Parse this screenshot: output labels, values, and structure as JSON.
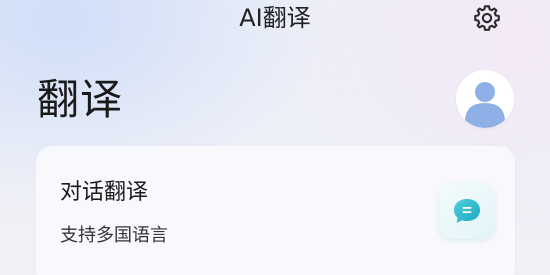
{
  "header": {
    "app_title": "AI翻译",
    "settings_icon": "gear-icon"
  },
  "page": {
    "title": "翻译",
    "avatar_icon": "user-avatar-icon"
  },
  "cards": [
    {
      "title": "对话翻译",
      "subtitle": "支持多国语言",
      "icon": "chat-bubble-icon",
      "accent_color": "#2fb7c9"
    }
  ]
}
